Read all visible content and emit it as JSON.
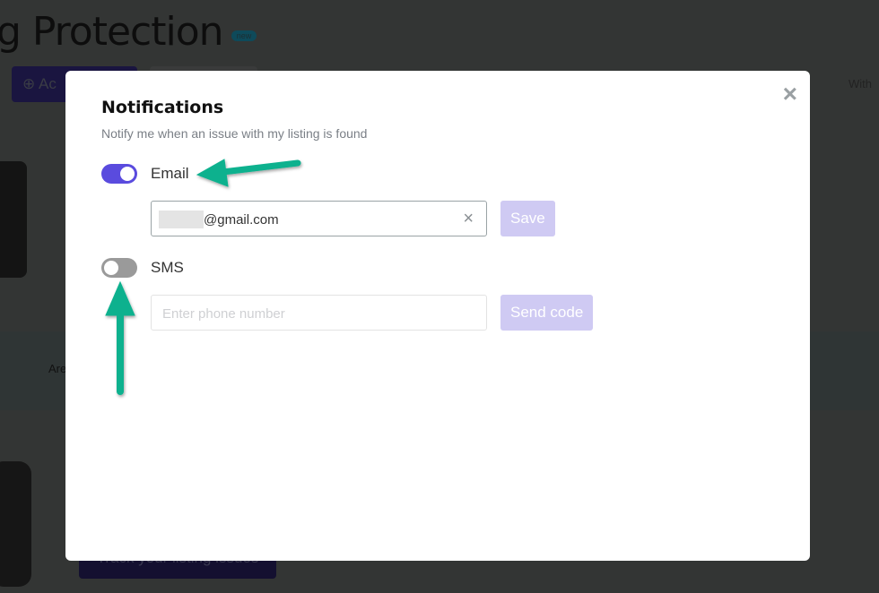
{
  "background": {
    "page_title": "g Protection",
    "badge": "new",
    "add_button": "⊕ Ac",
    "right_text": "With",
    "band_text": "Are",
    "track_button": "Track your listing issues"
  },
  "modal": {
    "title": "Notifications",
    "subtitle": "Notify me when an issue with my listing is found",
    "close_icon": "×",
    "email": {
      "label": "Email",
      "enabled": true,
      "value": "@gmail.com",
      "clear_icon": "×",
      "save_label": "Save"
    },
    "sms": {
      "label": "SMS",
      "enabled": false,
      "placeholder": "Enter phone number",
      "send_label": "Send code"
    }
  },
  "colors": {
    "accent": "#5a4bde",
    "button_disabled": "#cfcaf3",
    "arrow": "#08b18e",
    "overlay": "#333534"
  }
}
